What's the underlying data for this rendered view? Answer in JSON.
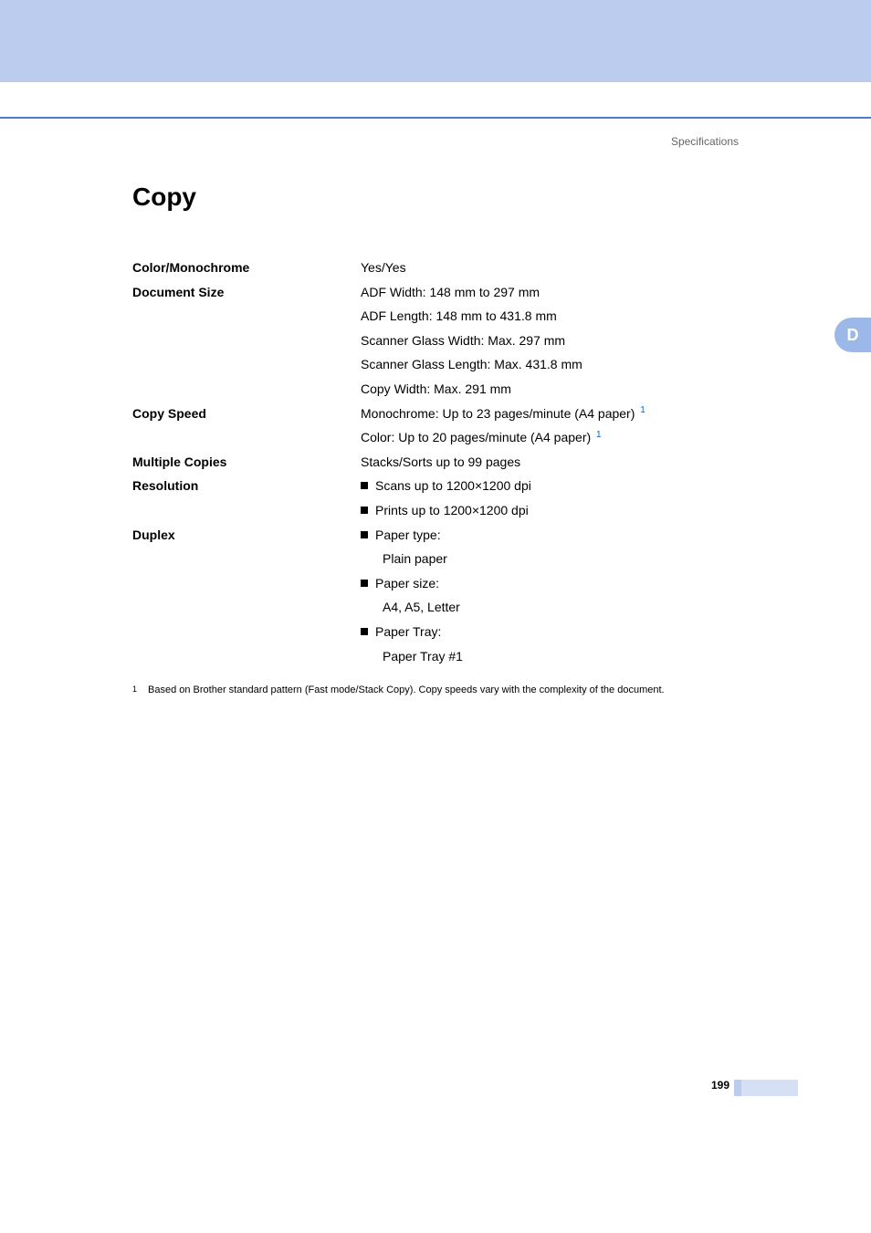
{
  "header": {
    "section_label": "Specifications",
    "side_tab": "D"
  },
  "title": "Copy",
  "specs": [
    {
      "label": "Color/Monochrome",
      "lines": [
        {
          "type": "plain",
          "text": "Yes/Yes"
        }
      ]
    },
    {
      "label": "Document Size",
      "lines": [
        {
          "type": "plain",
          "text": "ADF Width: 148 mm to 297 mm"
        },
        {
          "type": "plain",
          "text": "ADF Length: 148 mm to 431.8 mm"
        },
        {
          "type": "plain",
          "text": "Scanner Glass Width: Max. 297 mm"
        },
        {
          "type": "plain",
          "text": "Scanner Glass Length: Max. 431.8 mm"
        },
        {
          "type": "plain",
          "text": "Copy Width: Max. 291 mm"
        }
      ]
    },
    {
      "label": "Copy Speed",
      "lines": [
        {
          "type": "plain-sup",
          "text": "Monochrome: Up to 23 pages/minute (A4 paper)",
          "sup": "1"
        },
        {
          "type": "plain-sup",
          "text": "Color: Up to 20 pages/minute (A4 paper)",
          "sup": "1"
        }
      ]
    },
    {
      "label": "Multiple Copies",
      "lines": [
        {
          "type": "plain",
          "text": "Stacks/Sorts up to 99 pages"
        }
      ]
    },
    {
      "label": "Resolution",
      "lines": [
        {
          "type": "bullet",
          "text": "Scans up to 1200×1200 dpi"
        },
        {
          "type": "bullet",
          "text": "Prints up to 1200×1200 dpi"
        }
      ]
    },
    {
      "label": "Duplex",
      "lines": [
        {
          "type": "bullet",
          "text": "Paper type:"
        },
        {
          "type": "sub",
          "text": "Plain paper"
        },
        {
          "type": "bullet",
          "text": "Paper size:"
        },
        {
          "type": "sub",
          "text": "A4, A5, Letter"
        },
        {
          "type": "bullet",
          "text": "Paper Tray:"
        },
        {
          "type": "sub",
          "text": "Paper Tray #1"
        }
      ]
    }
  ],
  "footnote": {
    "num": "1",
    "text": "Based on Brother standard pattern (Fast mode/Stack Copy). Copy speeds vary with the complexity of the document."
  },
  "page_number": "199"
}
